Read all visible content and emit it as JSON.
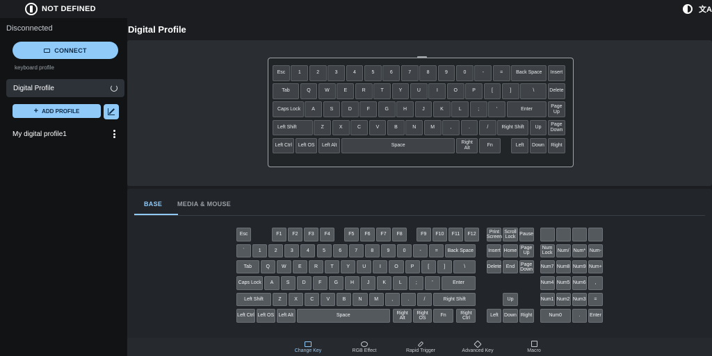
{
  "app": {
    "name": "NOT DEFINED"
  },
  "sidebar": {
    "status": "Disconnected",
    "connect_label": "CONNECT",
    "keyboard_profile_label": "keyboard profile",
    "active_profile": "Digital Profile",
    "add_profile_label": "ADD PROFILE",
    "profiles": [
      "My digital profile1"
    ]
  },
  "main": {
    "title": "Digital Profile"
  },
  "tabs": {
    "base": "BASE",
    "media": "MEDIA & MOUSE"
  },
  "nav": {
    "change_key": "Change Key",
    "rgb_effect": "RGB Effect",
    "rapid_trigger": "Rapid Trigger",
    "advanced_key": "Advanced Key",
    "macro": "Macro"
  },
  "keyboard_rows": [
    [
      "Esc",
      "1",
      "2",
      "3",
      "4",
      "5",
      "6",
      "7",
      "8",
      "9",
      "0",
      "-",
      "=",
      "Back Space",
      "Insert"
    ],
    [
      "Tab",
      "Q",
      "W",
      "E",
      "R",
      "T",
      "Y",
      "U",
      "I",
      "O",
      "P",
      "[",
      "]",
      "\\",
      "Delete"
    ],
    [
      "Caps Lock",
      "A",
      "S",
      "D",
      "F",
      "G",
      "H",
      "J",
      "K",
      "L",
      ";",
      "'",
      "Enter",
      "Page Up"
    ],
    [
      "Left Shift",
      "Z",
      "X",
      "C",
      "V",
      "B",
      "N",
      "M",
      ",",
      ".",
      "/",
      "Right Shift",
      "Up",
      "Page Down"
    ],
    [
      "Left Ctrl",
      "Left OS",
      "Left Alt",
      "Space",
      "Right Alt",
      "Fn",
      "Left",
      "Down",
      "Right"
    ]
  ],
  "full_keyboard": {
    "row0": [
      "Esc",
      "F1",
      "F2",
      "F3",
      "F4",
      "F5",
      "F6",
      "F7",
      "F8",
      "F9",
      "F10",
      "F11",
      "F12",
      "Print Screen",
      "Scroll Lock",
      "Pause",
      "",
      "",
      "",
      ""
    ],
    "row1": [
      "`",
      "1",
      "2",
      "3",
      "4",
      "5",
      "6",
      "7",
      "8",
      "9",
      "0",
      "-",
      "=",
      "Back Space",
      "Insert",
      "Home",
      "Page Up",
      "Num Lock",
      "Num/",
      "Num*",
      "Num-"
    ],
    "row2": [
      "Tab",
      "Q",
      "W",
      "E",
      "R",
      "T",
      "Y",
      "U",
      "I",
      "O",
      "P",
      "[",
      "]",
      "\\",
      "Delete",
      "End",
      "Page Down",
      "Num7",
      "Num8",
      "Num9",
      "Num+"
    ],
    "row3": [
      "Caps Lock",
      "A",
      "S",
      "D",
      "F",
      "G",
      "H",
      "J",
      "K",
      "L",
      ";",
      "'",
      "Enter",
      "Num4",
      "Num5",
      "Num6",
      ","
    ],
    "row4": [
      "Left Shift",
      "Z",
      "X",
      "C",
      "V",
      "B",
      "N",
      "M",
      ",",
      ".",
      "/",
      "Right Shift",
      "Up",
      "Num1",
      "Num2",
      "Num3",
      "="
    ],
    "row5": [
      "Left Ctrl",
      "Left OS",
      "Left Alt",
      "Space",
      "Right Alt",
      "Right OS",
      "Fn",
      "Right Ctrl",
      "Left",
      "Down",
      "Right",
      "Num0",
      ".",
      "Enter"
    ]
  }
}
